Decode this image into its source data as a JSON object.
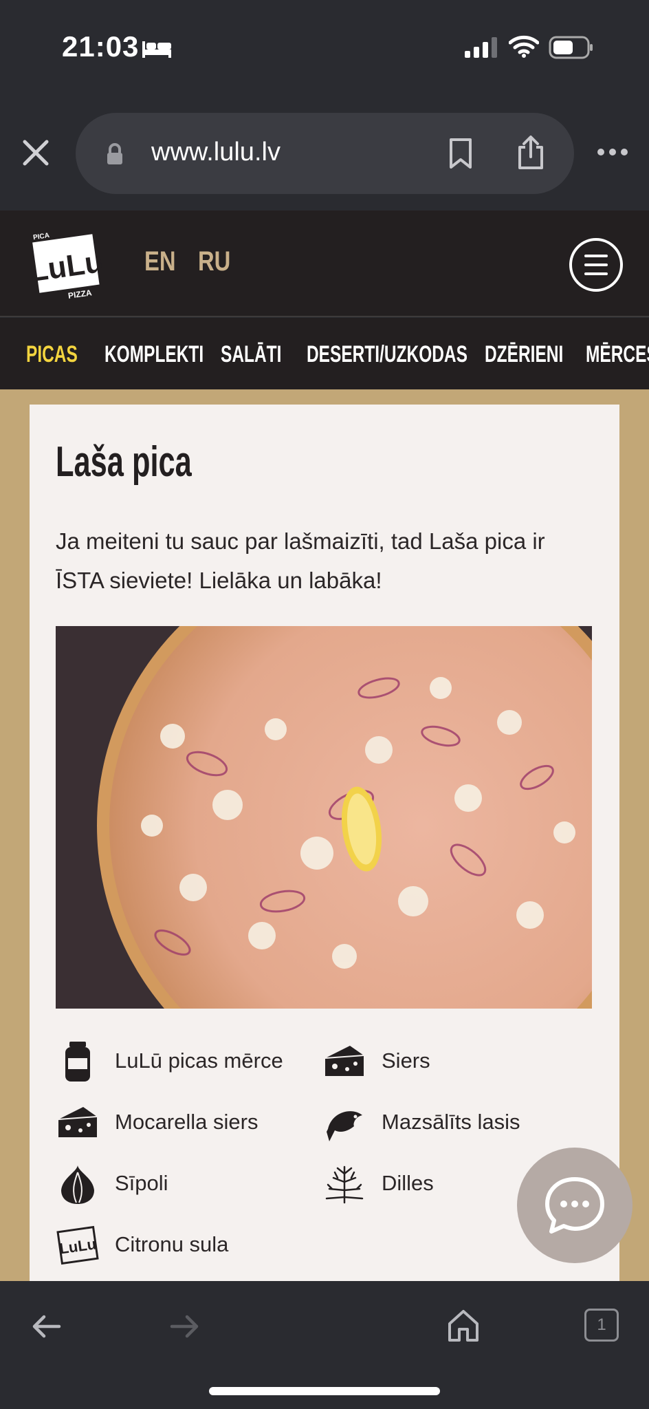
{
  "status_bar": {
    "time": "21:03"
  },
  "browser": {
    "url": "www.lulu.lv",
    "tabs_count": "1"
  },
  "site": {
    "logo_text": "LuLū",
    "languages": [
      "EN",
      "RU"
    ],
    "categories": [
      "PICAS",
      "KOMPLEKTI",
      "SALĀTI",
      "DESERTI/UZKODAS",
      "DZĒRIENI",
      "MĒRCES"
    ],
    "active_category": "PICAS"
  },
  "product": {
    "title": "Laša pica",
    "description": "Ja meiteni tu sauc par lašmaizīti, tad Laša pica ir ĪSTA sieviete! Lielāka un labāka!",
    "ingredients": [
      {
        "label": "LuLū picas mērce",
        "icon": "sauce-jar-icon"
      },
      {
        "label": "Siers",
        "icon": "cheese-icon"
      },
      {
        "label": "Mocarella siers",
        "icon": "cheese-icon"
      },
      {
        "label": "Mazsālīts lasis",
        "icon": "fish-icon"
      },
      {
        "label": "Sīpoli",
        "icon": "onion-icon"
      },
      {
        "label": "Dilles",
        "icon": "dill-icon"
      },
      {
        "label": "Citronu sula",
        "icon": "lulu-logo-icon"
      }
    ]
  },
  "colors": {
    "accent_active": "#f3d43f",
    "lang": "#c9b08a",
    "header_bg": "#231f20",
    "page_bg": "#c2a777"
  }
}
